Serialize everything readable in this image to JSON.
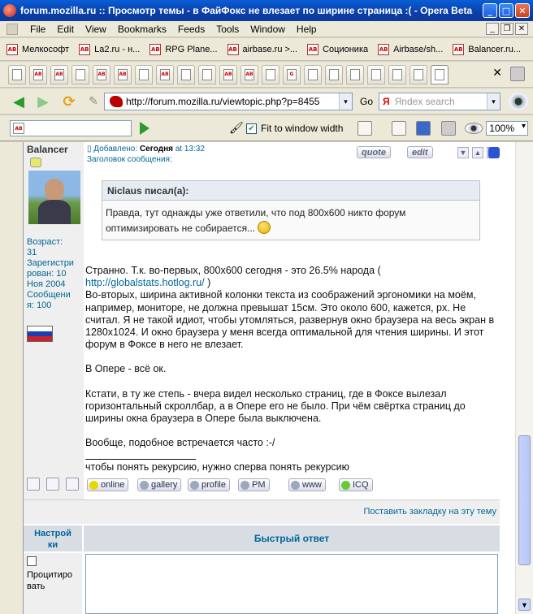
{
  "window": {
    "title": "forum.mozilla.ru :: Просмотр темы - в ФайФокс не влезает по ширине страница :( - Opera Beta"
  },
  "menu": {
    "items": [
      "File",
      "Edit",
      "View",
      "Bookmarks",
      "Feeds",
      "Tools",
      "Window",
      "Help"
    ]
  },
  "bookmarks": {
    "items": [
      "Мелкософт",
      "La2.ru - н...",
      "RPG Plane...",
      "airbase.ru >...",
      "Соционика",
      "Airbase/sh...",
      "Balancer.ru..."
    ]
  },
  "address": {
    "url": "http://forum.mozilla.ru/viewtopic.php?p=8455",
    "go_label": "Go",
    "search_brand": "Я",
    "search_placeholder": "Яndex search"
  },
  "toolbar2": {
    "fit_label": "Fit to window width",
    "fit_checked": true,
    "zoom": "100%"
  },
  "post": {
    "author": "Balancer",
    "added_prefix": "Добавлено:",
    "added_when": "Сегодня",
    "added_time": "at 13:32",
    "subject_label": "Заголовок сообщения:",
    "quote_btn": "quote",
    "edit_btn": "edit",
    "profile": {
      "age_label": "Возраст:",
      "age": "31",
      "reg_label_1": "Зарегистри",
      "reg_label_2": "рован: 10",
      "reg_label_3": "Ноя 2004",
      "msgs_label_1": "Сообщени",
      "msgs_label_2": "я: 100"
    },
    "quote": {
      "author": "Niclaus писал(а):",
      "text": "Правда, тут однажды уже ответили, что под 800x600 никто форум оптимизировать не собирается..."
    },
    "p1_a": "Странно. Т.к. во-первых, 800x600 сегодня - это 26.5% народа (",
    "p1_link": "http://globalstats.hotlog.ru/",
    "p1_b": ")",
    "p1_c": "Во-вторых, ширина активной колонки текста из соображений эргономики на моём, например, мониторе, не должна превышат 15см. Это около 600, кажется, px. Не считал. Я не такой идиот, чтобы утомляться, развернув окно браузера на весь экран в 1280x1024. И окно браузера у меня всегда оптимальной для чтения ширины. И этот форум в Фоксе в него не влезает.",
    "p2": "В Опере - всё ок.",
    "p3": "Кстати, в ту же степь - вчера видел несколько страниц, где в Фоксе вылезал горизонтальный скроллбар, а в Опере его не было. При чём свёртка страниц до ширины окна браузера в Опере была выключена.",
    "p4": "Вообще, подобное встречается часто :-/",
    "signature": "чтобы понять рекурсию, нужно сперва понять рекурсию",
    "foot_buttons": [
      "online",
      "gallery",
      "profile",
      "PM",
      "www",
      "ICQ"
    ]
  },
  "bookmark_link": "Поставить закладку на эту тему",
  "quick_reply": {
    "settings_label_1": "Настрой",
    "settings_label_2": "ки",
    "title": "Быстрый ответ",
    "quote_label_1": "Процитиро",
    "quote_label_2": "вать"
  }
}
